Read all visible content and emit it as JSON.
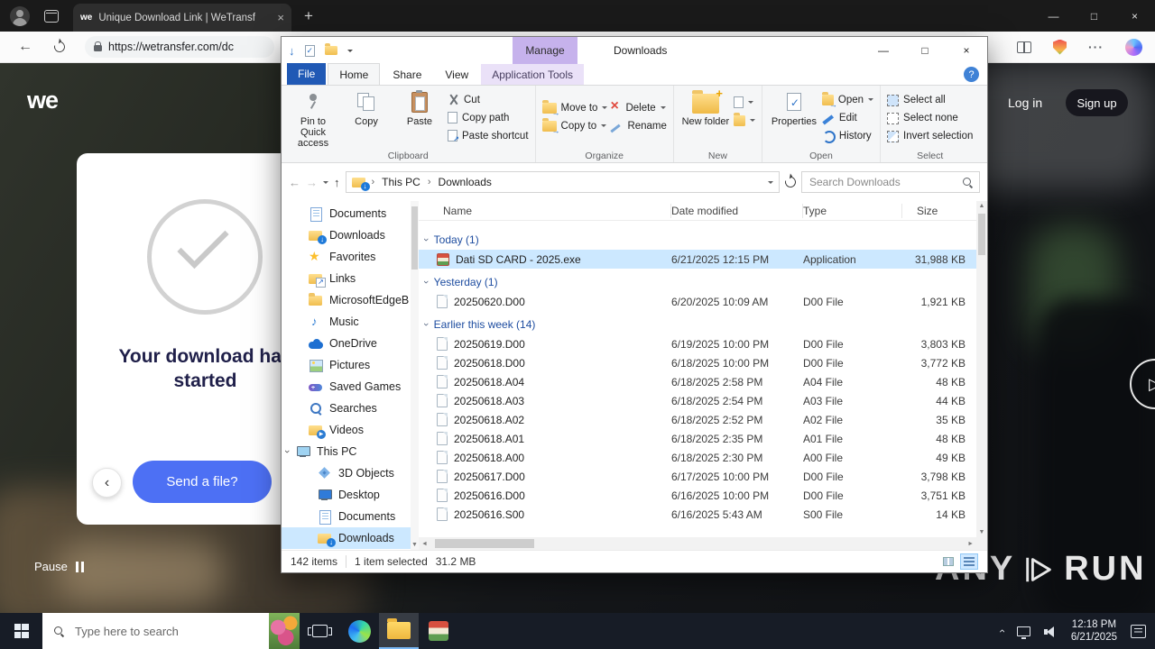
{
  "colors": {
    "selection_blue": "#cce8ff",
    "wetransfer_blue": "#4d70f4",
    "file_tab_blue": "#2059b5",
    "manage_purple": "#c6b2ec",
    "taskbar_dark": "#171c26"
  },
  "browser": {
    "tab": {
      "favicon": "we",
      "title": "Unique Download Link | WeTransf",
      "close_icon": "×"
    },
    "new_tab_icon": "+",
    "controls": {
      "minimize": "—",
      "maximize": "□",
      "close": "×"
    },
    "toolbar": {
      "back_icon": "←",
      "url": "https://wetransfer.com/dc",
      "more_icon": "···"
    }
  },
  "wetransfer": {
    "logo": "we",
    "login_label": "Log in",
    "signup_label": "Sign up",
    "headline_line1": "Your download has",
    "headline_line2": "started",
    "send_file_label": "Send a file?",
    "back_icon": "‹",
    "pause_label": "Pause",
    "play_icon": "▷"
  },
  "explorer": {
    "window_title": "Downloads",
    "manage_label": "Manage",
    "help_icon": "?",
    "controls": {
      "minimize": "—",
      "maximize": "□",
      "close": "×"
    },
    "tabs": {
      "file": "File",
      "home": "Home",
      "share": "Share",
      "view": "View",
      "app_tools": "Application Tools"
    },
    "ribbon": {
      "clipboard": {
        "group": "Clipboard",
        "pin": "Pin to Quick access",
        "copy": "Copy",
        "paste": "Paste",
        "cut": "Cut",
        "copy_path": "Copy path",
        "paste_shortcut": "Paste shortcut"
      },
      "organize": {
        "group": "Organize",
        "move_to": "Move to",
        "copy_to": "Copy to",
        "delete": "Delete",
        "rename": "Rename"
      },
      "new": {
        "group": "New",
        "new_folder": "New folder"
      },
      "open": {
        "group": "Open",
        "properties": "Properties",
        "open": "Open",
        "edit": "Edit",
        "history": "History"
      },
      "select": {
        "group": "Select",
        "select_all": "Select all",
        "select_none": "Select none",
        "invert_selection": "Invert selection"
      }
    },
    "address": {
      "back_icon": "←",
      "forward_icon": "→",
      "up_icon": "↑",
      "crumb_root": "This PC",
      "crumb_sep": "›",
      "crumb_current": "Downloads",
      "search_placeholder": "Search Downloads"
    },
    "columns": [
      "Name",
      "Date modified",
      "Type",
      "Size"
    ],
    "sidebar": [
      {
        "label": "Documents",
        "icon": "documents"
      },
      {
        "label": "Downloads",
        "icon": "downloads"
      },
      {
        "label": "Favorites",
        "icon": "favorites"
      },
      {
        "label": "Links",
        "icon": "links"
      },
      {
        "label": "MicrosoftEdgeB",
        "icon": "folder"
      },
      {
        "label": "Music",
        "icon": "music"
      },
      {
        "label": "OneDrive",
        "icon": "onedrive"
      },
      {
        "label": "Pictures",
        "icon": "pictures"
      },
      {
        "label": "Saved Games",
        "icon": "games"
      },
      {
        "label": "Searches",
        "icon": "searches"
      },
      {
        "label": "Videos",
        "icon": "videos"
      },
      {
        "label": "This PC",
        "icon": "thispc",
        "root": true,
        "expanded": true
      },
      {
        "label": "3D Objects",
        "icon": "objects3d",
        "indent": true
      },
      {
        "label": "Desktop",
        "icon": "desktop",
        "indent": true
      },
      {
        "label": "Documents",
        "icon": "documents",
        "indent": true
      },
      {
        "label": "Downloads",
        "icon": "downloads",
        "indent": true,
        "selected": true
      }
    ],
    "groups": [
      {
        "label": "Today (1)",
        "rows": [
          {
            "name": "Dati SD CARD - 2025.exe",
            "date": "6/21/2025 12:15 PM",
            "type": "Application",
            "size": "31,988 KB",
            "icon": "app",
            "selected": true
          }
        ]
      },
      {
        "label": "Yesterday (1)",
        "rows": [
          {
            "name": "20250620.D00",
            "date": "6/20/2025 10:09 AM",
            "type": "D00 File",
            "size": "1,921 KB",
            "icon": "file"
          }
        ]
      },
      {
        "label": "Earlier this week (14)",
        "rows": [
          {
            "name": "20250619.D00",
            "date": "6/19/2025 10:00 PM",
            "type": "D00 File",
            "size": "3,803 KB",
            "icon": "file"
          },
          {
            "name": "20250618.D00",
            "date": "6/18/2025 10:00 PM",
            "type": "D00 File",
            "size": "3,772 KB",
            "icon": "file"
          },
          {
            "name": "20250618.A04",
            "date": "6/18/2025 2:58 PM",
            "type": "A04 File",
            "size": "48 KB",
            "icon": "file"
          },
          {
            "name": "20250618.A03",
            "date": "6/18/2025 2:54 PM",
            "type": "A03 File",
            "size": "44 KB",
            "icon": "file"
          },
          {
            "name": "20250618.A02",
            "date": "6/18/2025 2:52 PM",
            "type": "A02 File",
            "size": "35 KB",
            "icon": "file"
          },
          {
            "name": "20250618.A01",
            "date": "6/18/2025 2:35 PM",
            "type": "A01 File",
            "size": "48 KB",
            "icon": "file"
          },
          {
            "name": "20250618.A00",
            "date": "6/18/2025 2:30 PM",
            "type": "A00 File",
            "size": "49 KB",
            "icon": "file"
          },
          {
            "name": "20250617.D00",
            "date": "6/17/2025 10:00 PM",
            "type": "D00 File",
            "size": "3,798 KB",
            "icon": "file"
          },
          {
            "name": "20250616.D00",
            "date": "6/16/2025 10:00 PM",
            "type": "D00 File",
            "size": "3,751 KB",
            "icon": "file"
          },
          {
            "name": "20250616.S00",
            "date": "6/16/2025 5:43 AM",
            "type": "S00 File",
            "size": "14 KB",
            "icon": "file"
          }
        ]
      }
    ],
    "status": {
      "items_count": "142 items",
      "selection_info": "1 item selected",
      "selection_size": "31.2 MB"
    }
  },
  "taskbar": {
    "search_placeholder": "Type here to search",
    "clock_time": "12:18 PM",
    "clock_date": "6/21/2025"
  },
  "watermark": {
    "left": "ANY",
    "right": "RUN"
  }
}
